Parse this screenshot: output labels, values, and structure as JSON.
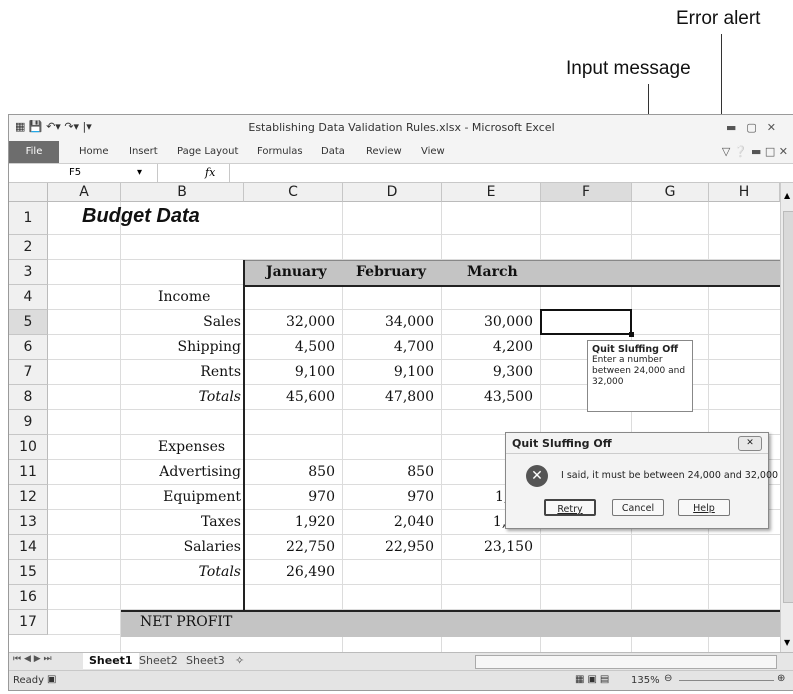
{
  "callouts": {
    "error_alert": "Error alert",
    "input_message": "Input message"
  },
  "window": {
    "title": "Establishing Data Validation Rules.xlsx - Microsoft Excel",
    "tabs": [
      "File",
      "Home",
      "Insert",
      "Page Layout",
      "Formulas",
      "Data",
      "Review",
      "View"
    ]
  },
  "formula_bar": {
    "name_box": "F5",
    "fx": "fx",
    "value": ""
  },
  "columns": [
    "A",
    "B",
    "C",
    "D",
    "E",
    "F",
    "G",
    "H"
  ],
  "rows": [
    "1",
    "2",
    "3",
    "4",
    "5",
    "6",
    "7",
    "8",
    "9",
    "10",
    "11",
    "12",
    "13",
    "14",
    "15",
    "16",
    "17"
  ],
  "sheet": {
    "title": "Budget Data",
    "months": [
      "January",
      "February",
      "March"
    ],
    "income_label": "Income",
    "income_rows": [
      {
        "label": "Sales",
        "values": [
          "32,000",
          "34,000",
          "30,000"
        ]
      },
      {
        "label": "Shipping",
        "values": [
          "4,500",
          "4,700",
          "4,200"
        ]
      },
      {
        "label": "Rents",
        "values": [
          "9,100",
          "9,100",
          "9,300"
        ]
      },
      {
        "label": "Totals",
        "values": [
          "45,600",
          "47,800",
          "43,500"
        ]
      }
    ],
    "expenses_label": "Expenses",
    "expense_rows": [
      {
        "label": "Advertising",
        "values": [
          "850",
          "850",
          ""
        ]
      },
      {
        "label": "Equipment",
        "values": [
          "970",
          "970",
          "1,"
        ]
      },
      {
        "label": "Taxes",
        "values": [
          "1,920",
          "2,040",
          "1,800"
        ]
      },
      {
        "label": "Salaries",
        "values": [
          "22,750",
          "22,950",
          "23,150"
        ]
      },
      {
        "label": "Totals",
        "values": [
          "26,490",
          "",
          ""
        ]
      }
    ],
    "net_profit": "NET PROFIT"
  },
  "input_message": {
    "title": "Quit Sluffing Off",
    "body": "Enter a number between 24,000 and 32,000"
  },
  "error_dialog": {
    "title": "Quit Sluffing Off",
    "message": "I said, it must be between 24,000 and 32,000",
    "buttons": {
      "retry": "Retry",
      "cancel": "Cancel",
      "help": "Help"
    },
    "icon": "error-x-icon"
  },
  "sheet_tabs": [
    "Sheet1",
    "Sheet2",
    "Sheet3"
  ],
  "status": {
    "ready": "Ready",
    "zoom": "135%"
  }
}
